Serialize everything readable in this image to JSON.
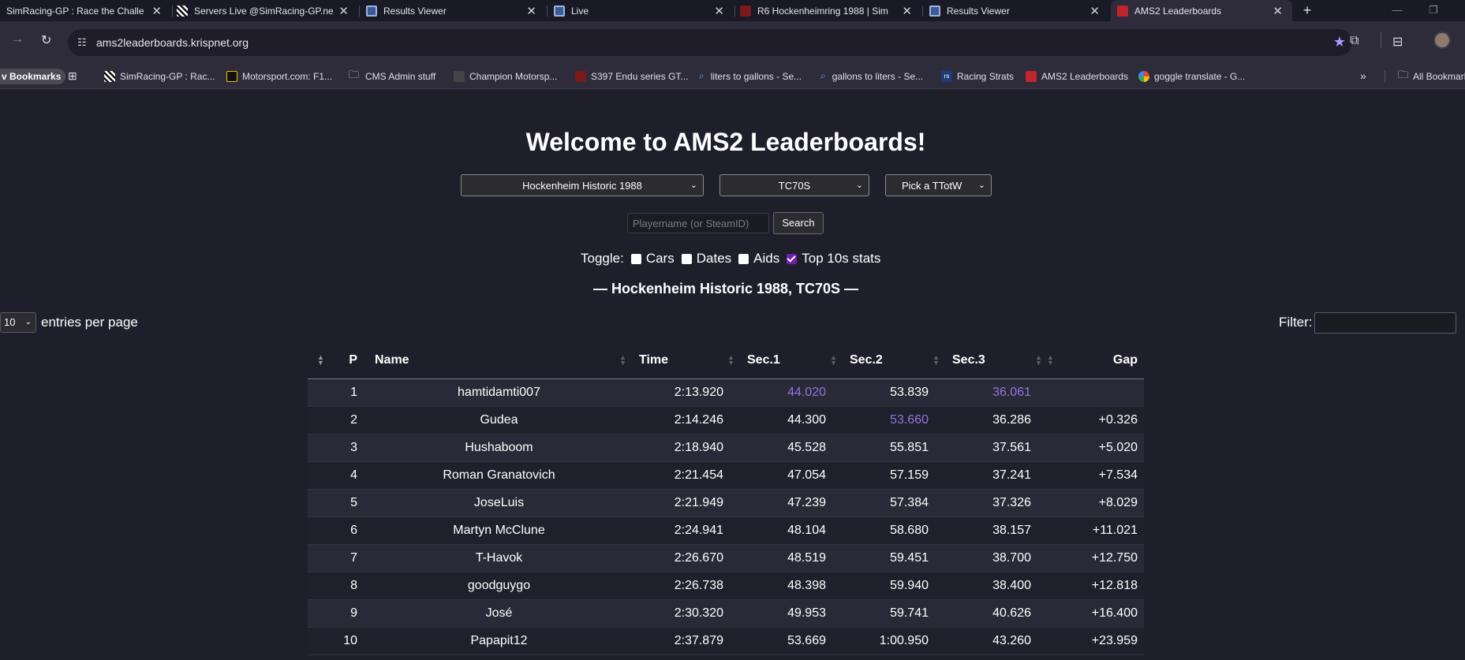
{
  "browser": {
    "tabs": [
      {
        "title": "SimRacing-GP : Race the Challe",
        "active": false
      },
      {
        "title": "Servers Live @SimRacing-GP.ne",
        "active": false
      },
      {
        "title": "Results Viewer",
        "active": false
      },
      {
        "title": "Live",
        "active": false
      },
      {
        "title": "R6 Hockenheimring 1988 | Sim",
        "active": false
      },
      {
        "title": "Results Viewer",
        "active": false
      },
      {
        "title": "AMS2 Leaderboards",
        "active": true
      }
    ],
    "url": "ams2leaderboards.krispnet.org",
    "bookmarks_label": "v Bookmarks",
    "bookmarks": [
      "SimRacing-GP : Rac...",
      "Motorsport.com: F1...",
      "CMS Admin stuff",
      "Champion Motorsp...",
      "S397 Endu series GT...",
      "liters to gallons - Se...",
      "gallons to liters - Se...",
      "Racing Strats",
      "AMS2 Leaderboards",
      "goggle translate - G..."
    ],
    "all_bookmarks": "All Bookmarks"
  },
  "page": {
    "heading": "Welcome to AMS2 Leaderboards!",
    "track_select": "Hockenheim Historic 1988",
    "class_select": "TC70S",
    "ttotw_select": "Pick a TTotW",
    "search_placeholder": "Playername (or SteamID)",
    "search_button": "Search",
    "toggle_label": "Toggle:",
    "toggles": {
      "cars": "Cars",
      "dates": "Dates",
      "aids": "Aids",
      "top10": "Top 10s stats"
    },
    "subheading": "— Hockenheim Historic 1988, TC70S —",
    "entries_value": "10",
    "entries_label": "entries per page",
    "filter_label": "Filter:"
  },
  "table": {
    "headers": {
      "p": "P",
      "name": "Name",
      "time": "Time",
      "sec1": "Sec.1",
      "sec2": "Sec.2",
      "sec3": "Sec.3",
      "gap": "Gap"
    },
    "rows": [
      {
        "p": "1",
        "name": "hamtidamti007",
        "time": "2:13.920",
        "sec1": "44.020",
        "sec2": "53.839",
        "sec3": "36.061",
        "gap": ""
      },
      {
        "p": "2",
        "name": "Gudea",
        "time": "2:14.246",
        "sec1": "44.300",
        "sec2": "53.660",
        "sec3": "36.286",
        "gap": "+0.326"
      },
      {
        "p": "3",
        "name": "Hushaboom",
        "time": "2:18.940",
        "sec1": "45.528",
        "sec2": "55.851",
        "sec3": "37.561",
        "gap": "+5.020"
      },
      {
        "p": "4",
        "name": "Roman Granatovich",
        "time": "2:21.454",
        "sec1": "47.054",
        "sec2": "57.159",
        "sec3": "37.241",
        "gap": "+7.534"
      },
      {
        "p": "5",
        "name": "JoseLuis",
        "time": "2:21.949",
        "sec1": "47.239",
        "sec2": "57.384",
        "sec3": "37.326",
        "gap": "+8.029"
      },
      {
        "p": "6",
        "name": "Martyn McClune",
        "time": "2:24.941",
        "sec1": "48.104",
        "sec2": "58.680",
        "sec3": "38.157",
        "gap": "+11.021"
      },
      {
        "p": "7",
        "name": "T-Havok",
        "time": "2:26.670",
        "sec1": "48.519",
        "sec2": "59.451",
        "sec3": "38.700",
        "gap": "+12.750"
      },
      {
        "p": "8",
        "name": "goodguygo",
        "time": "2:26.738",
        "sec1": "48.398",
        "sec2": "59.940",
        "sec3": "38.400",
        "gap": "+12.818"
      },
      {
        "p": "9",
        "name": "José",
        "time": "2:30.320",
        "sec1": "49.953",
        "sec2": "59.741",
        "sec3": "40.626",
        "gap": "+16.400"
      },
      {
        "p": "10",
        "name": "Papapit12",
        "time": "2:37.879",
        "sec1": "53.669",
        "sec2": "1:00.950",
        "sec3": "43.260",
        "gap": "+23.959"
      }
    ]
  },
  "colors": {
    "page_bg": "#1f1e2b",
    "best_sector": "#9276e0",
    "toggle_checked": "#6e1fb0"
  }
}
